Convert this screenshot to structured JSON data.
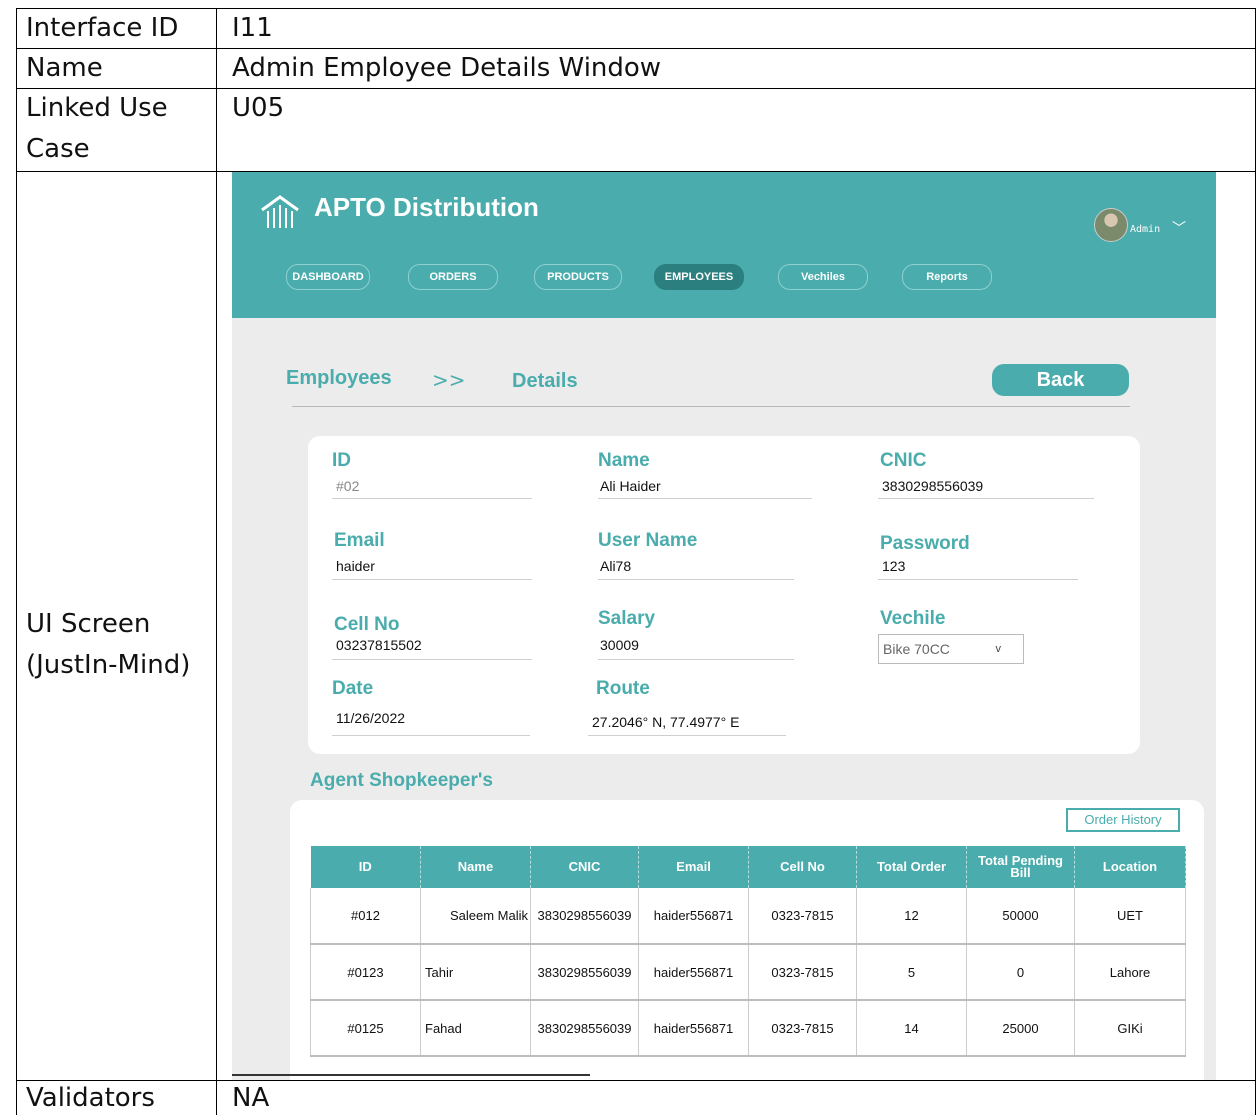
{
  "doc": {
    "rows": [
      {
        "label": "Interface ID",
        "value": "I11"
      },
      {
        "label": "Name",
        "value": "Admin Employee Details Window"
      },
      {
        "label": "Linked Use Case",
        "value": "U05"
      },
      {
        "label": "UI Screen (JustIn-Mind)",
        "value": ""
      },
      {
        "label": "Validators",
        "value": "NA"
      }
    ]
  },
  "app": {
    "brand": "APTO Distribution",
    "user": "Admin",
    "nav": [
      "DASHBOARD",
      "ORDERS",
      "PRODUCTS",
      "EMPLOYEES",
      "Vechiles",
      "Reports"
    ],
    "active_nav": "EMPLOYEES"
  },
  "breadcrumb": {
    "root": "Employees",
    "sep": ">>",
    "current": "Details"
  },
  "back_label": "Back",
  "employee": {
    "id": {
      "label": "ID",
      "value": "#02"
    },
    "name": {
      "label": "Name",
      "value": "Ali Haider"
    },
    "cnic": {
      "label": "CNIC",
      "value": "3830298556039"
    },
    "email": {
      "label": "Email",
      "value": "haider"
    },
    "username": {
      "label": "User Name",
      "value": "Ali78"
    },
    "password": {
      "label": "Password",
      "value": "123"
    },
    "cell": {
      "label": "Cell No",
      "value": "03237815502"
    },
    "salary": {
      "label": "Salary",
      "value": "30009"
    },
    "vehicle": {
      "label": "Vechile",
      "value": "Bike 70CC"
    },
    "date": {
      "label": "Date",
      "value": "11/26/2022"
    },
    "route": {
      "label": "Route",
      "value": "27.2046° N, 77.4977° E"
    }
  },
  "agents": {
    "title": "Agent Shopkeeper's",
    "order_history_label": "Order History",
    "columns": [
      "ID",
      "Name",
      "CNIC",
      "Email",
      "Cell No",
      "Total Order",
      "Total Pending Bill",
      "Location"
    ],
    "rows": [
      [
        "#012",
        "Saleem Malik",
        "3830298556039",
        "haider556871",
        "0323-7815",
        "12",
        "50000",
        "UET"
      ],
      [
        "#0123",
        "Tahir",
        "3830298556039",
        "haider556871",
        "0323-7815",
        "5",
        "0",
        "Lahore"
      ],
      [
        "#0125",
        "Fahad",
        "3830298556039",
        "haider556871",
        "0323-7815",
        "14",
        "25000",
        "GIKi"
      ]
    ]
  },
  "colors": {
    "accent": "#4aacac",
    "active_nav": "#2c7f7f",
    "panel_bg": "#ececec"
  },
  "icons": {
    "logo": "building-columns-icon",
    "user_menu": "chevron-down-icon",
    "select": "chevron-down-icon"
  }
}
